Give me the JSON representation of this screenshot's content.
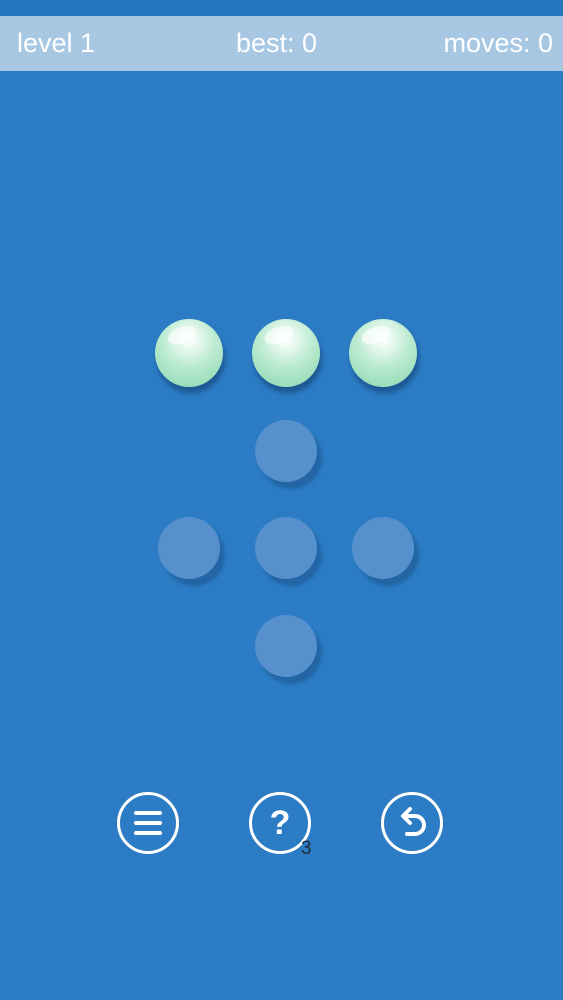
{
  "header": {
    "level_text": "level 1",
    "best_text": "best: 0",
    "moves_text": "moves: 0"
  },
  "board": {
    "balls": [
      {
        "row": 0,
        "col": 0
      },
      {
        "row": 0,
        "col": 1
      },
      {
        "row": 0,
        "col": 2
      }
    ],
    "empty_holes": [
      {
        "row": 1,
        "col": 1
      },
      {
        "row": 2,
        "col": 0
      },
      {
        "row": 2,
        "col": 1
      },
      {
        "row": 2,
        "col": 2
      },
      {
        "row": 3,
        "col": 1
      }
    ]
  },
  "controls": {
    "hint_count": "3",
    "icons": [
      "menu-icon",
      "help-icon",
      "undo-icon"
    ]
  },
  "colors": {
    "background": "#2b7cc4",
    "header_bar": "#a7c7e3",
    "ball": "#9fe0bd",
    "hole": "#5691ce"
  }
}
